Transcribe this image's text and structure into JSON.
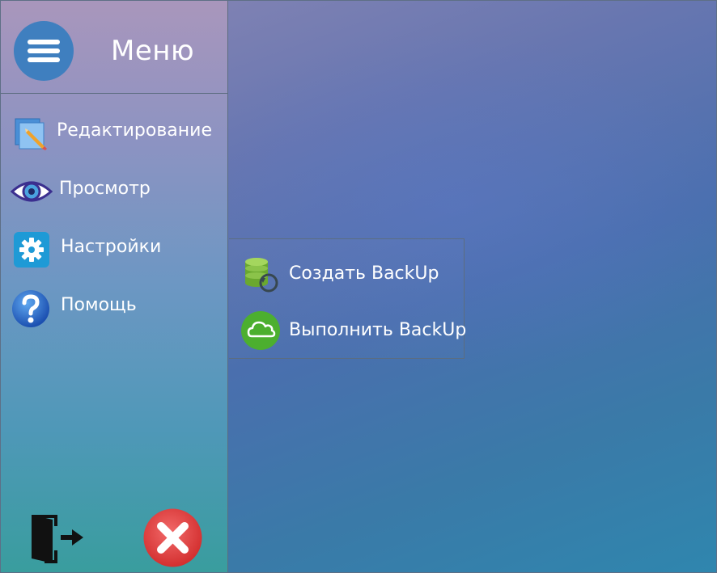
{
  "menu": {
    "title": "Меню",
    "toggle_icon": "hamburger-icon"
  },
  "sidebar": {
    "items": [
      {
        "label": "Редактирование",
        "icon": "edit-icon"
      },
      {
        "label": "Просмотр",
        "icon": "eye-icon"
      },
      {
        "label": "Настройки",
        "icon": "gear-icon"
      },
      {
        "label": "Помощь",
        "icon": "help-icon"
      }
    ],
    "footer": {
      "exit_icon": "exit-door-icon",
      "close_icon": "close-icon"
    }
  },
  "submenu": {
    "items": [
      {
        "label": "Создать BackUp",
        "icon": "database-backup-icon"
      },
      {
        "label": "Выполнить BackUp",
        "icon": "cloud-icon"
      }
    ]
  },
  "colors": {
    "hamburger_bg": "#3f7fbf",
    "close_red": "#e23d3d",
    "cloud_green": "#4caf2f",
    "gear_blue": "#1e9ad6",
    "text": "#ffffff"
  }
}
